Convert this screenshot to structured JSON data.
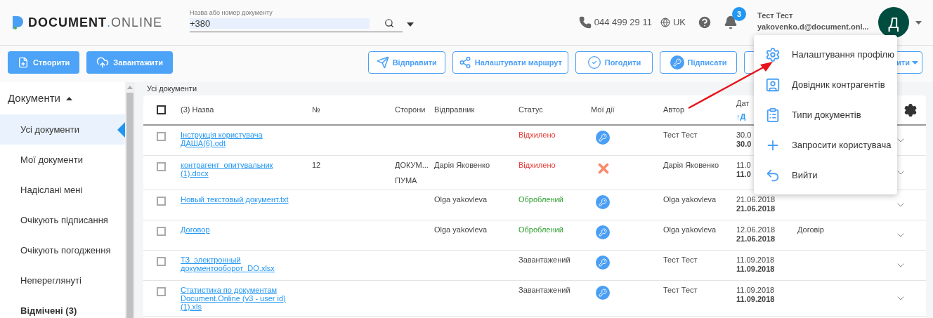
{
  "logo": {
    "bold": "DOCUMENT",
    "dot": ".",
    "light": "ONLINE"
  },
  "search": {
    "label": "Назва або номер документу",
    "value": "+380"
  },
  "header": {
    "phone": "044 499 29 11",
    "language": "UK",
    "notifications": "3",
    "user_name": "Тест Тест",
    "user_email": "yakovenko.d@document.onl...",
    "avatar": "Д"
  },
  "toolbar": {
    "left": [
      {
        "label": "Створити",
        "kind": "create"
      },
      {
        "label": "Завантажити",
        "kind": "upload"
      }
    ],
    "right": [
      {
        "label": "Відправити",
        "kind": "send"
      },
      {
        "label": "Налаштувати маршрут",
        "kind": "route"
      },
      {
        "label": "Погодити",
        "kind": "approve"
      },
      {
        "label": "Підписати",
        "kind": "sign"
      },
      {
        "label": "ити",
        "kind": "more"
      }
    ]
  },
  "sidebar": {
    "title": "Документи",
    "expanded": true,
    "items": [
      {
        "label": "Усі документи",
        "selected": true,
        "emphasized": false
      },
      {
        "label": "Мої документи",
        "selected": false,
        "emphasized": false
      },
      {
        "label": "Надіслані мені",
        "selected": false,
        "emphasized": false
      },
      {
        "label": "Очікують підписання",
        "selected": false,
        "emphasized": false
      },
      {
        "label": "Очікують погодження",
        "selected": false,
        "emphasized": false
      },
      {
        "label": "Непереглянуті",
        "selected": false,
        "emphasized": false
      },
      {
        "label": "Відмічені (3)",
        "selected": false,
        "emphasized": true
      }
    ]
  },
  "breadcrumb": "Усі документи",
  "table": {
    "columns": [
      "(3) Назва",
      "№",
      "Сторони",
      "Відправник",
      "Статус",
      "Мої дії",
      "Автор",
      "Дат"
    ],
    "sort_label": "↑Д",
    "all_checked": false,
    "rows": [
      {
        "checked": false,
        "name": "Інструкція користувача ДАША(6).odt",
        "status": {
          "label": "Відхилено",
          "kind": "rejected"
        },
        "action": {
          "kind": "sign"
        },
        "author": "Тест Тест",
        "date1": "30.0",
        "date2": "30.0"
      },
      {
        "checked": false,
        "name": "контрагент_опитувальник (1).docx",
        "number": "12",
        "parties": [
          "ДОКУМ...",
          "ПУМА"
        ],
        "sender": "Дарія Яковенко",
        "status": {
          "label": "Відхилено",
          "kind": "rejected"
        },
        "action": {
          "kind": "declined"
        },
        "author": "Дарія Яковенко",
        "date1": "11.0",
        "date2": "11.0"
      },
      {
        "checked": false,
        "name": "Новый текстовый документ.txt",
        "sender": "Olga yakovleva",
        "status": {
          "label": "Оброблений",
          "kind": "processed"
        },
        "action": {
          "kind": "sign"
        },
        "author": "Olga yakovleva",
        "date1": "21.06.2018",
        "date2": "21.06.2018"
      },
      {
        "checked": false,
        "name": "Договор",
        "sender": "Olga yakovleva",
        "status": {
          "label": "Оброблений",
          "kind": "processed"
        },
        "action": {
          "kind": "sign"
        },
        "author": "Olga yakovleva",
        "date1": "12.06.2018",
        "date2": "21.06.2018",
        "type": "Договір"
      },
      {
        "checked": false,
        "name": "ТЗ_электронный документооборот_DO.xlsx",
        "status": {
          "label": "Завантажений",
          "kind": "uploaded"
        },
        "action": {
          "kind": "sign"
        },
        "author": "Тест Тест",
        "date1": "11.09.2018",
        "date2": "11.09.2018"
      },
      {
        "checked": false,
        "name": "Статистика по документам Document.Online (v3 - user id) (1).xls",
        "status": {
          "label": "Завантажений",
          "kind": "uploaded"
        },
        "action": {
          "kind": "sign"
        },
        "author": "Тест Тест",
        "date1": "11.09.2018",
        "date2": "11.09.2018"
      }
    ]
  },
  "profile_menu": {
    "items": [
      {
        "label": "Налаштування профілю",
        "kind": "settings"
      },
      {
        "label": "Довідник контрагентів",
        "kind": "contacts"
      },
      {
        "label": "Типи документів",
        "kind": "types"
      },
      {
        "label": "Запросити користувача",
        "kind": "invite"
      },
      {
        "label": "Вийти",
        "kind": "logout"
      }
    ]
  }
}
